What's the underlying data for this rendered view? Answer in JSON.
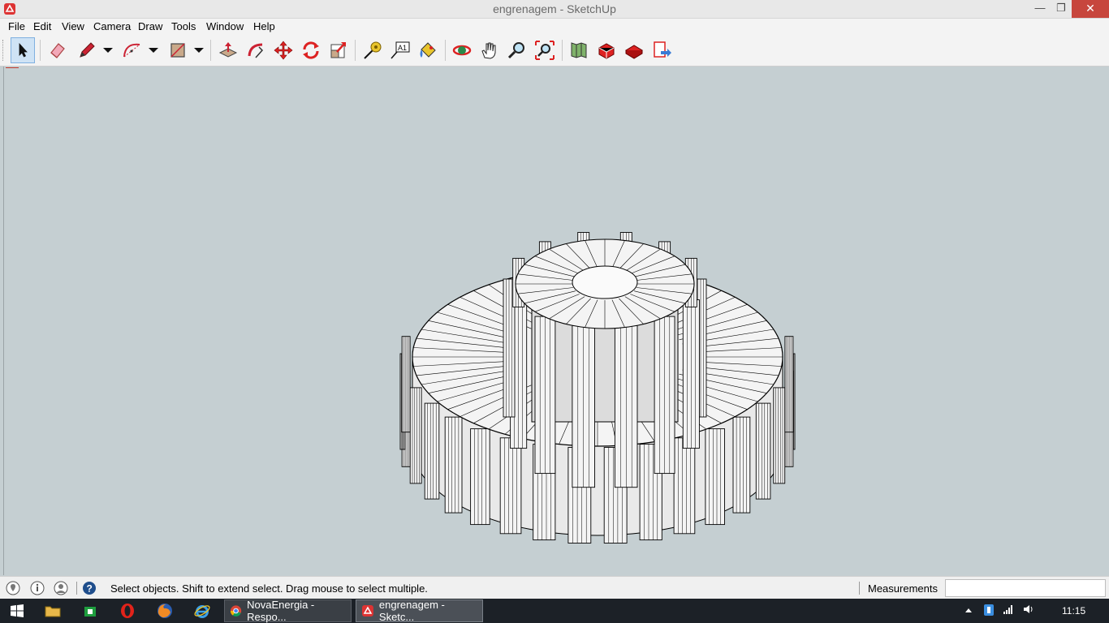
{
  "window": {
    "title": "engrenagem - SketchUp",
    "minimize": "—",
    "restore": "❐",
    "close": "✕"
  },
  "menu": [
    "File",
    "Edit",
    "View",
    "Camera",
    "Draw",
    "Tools",
    "Window",
    "Help"
  ],
  "toolbar": {
    "tools": [
      "select-tool",
      "eraser-tool",
      "line-tool",
      "arc-tool",
      "shape-tool",
      "push-pull-tool",
      "offset-tool",
      "move-tool",
      "rotate-tool",
      "scale-tool",
      "tape-measure-tool",
      "text-tool",
      "paint-bucket-tool",
      "orbit-tool",
      "pan-tool",
      "zoom-tool",
      "zoom-extents-tool",
      "warehouse-tool",
      "share-model-tool",
      "extension-warehouse-tool",
      "layout-send-tool"
    ],
    "active_tool": "select-tool",
    "text_tool_label": "A1"
  },
  "status": {
    "message": "Select objects. Shift to extend select. Drag mouse to select multiple.",
    "measurements_label": "Measurements",
    "measurements_value": ""
  },
  "taskbar": {
    "tasks": [
      {
        "label": "NovaEnergia - Respo...",
        "icon": "chrome-icon"
      },
      {
        "label": "engrenagem - Sketc...",
        "icon": "sketchup-icon"
      }
    ],
    "clock": "11:15"
  },
  "colors": {
    "viewport_bg": "#c5cfd2",
    "title_close": "#c7463d",
    "taskbar_bg": "#1c2127",
    "model_face": "#f4f4f4",
    "model_edge": "#000000"
  }
}
